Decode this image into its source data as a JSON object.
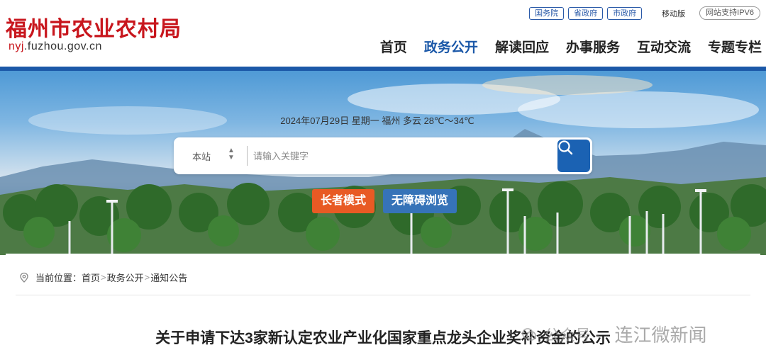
{
  "header": {
    "logo_text": "福州市农业农村局",
    "domain_prefix": "nyj",
    "domain_rest": ".fuzhou.gov.cn",
    "top_links": [
      "国务院",
      "省政府",
      "市政府"
    ],
    "mobile_label": "移动版",
    "ipv6_label": "网站支持IPV6",
    "nav": [
      "首页",
      "政务公开",
      "解读回应",
      "办事服务",
      "互动交流",
      "专题专栏"
    ],
    "active_nav": "政务公开",
    "brand_color": "#c8161d",
    "accent_color": "#1b58a8"
  },
  "banner": {
    "date_weather": "2024年07月29日  星期一  福州  多云  28℃～34℃",
    "search": {
      "scope_label": "本站",
      "placeholder": "请输入关键字",
      "button_icon": "search-icon"
    },
    "elder_mode_label": "长者模式",
    "accessible_label": "无障碍浏览"
  },
  "content": {
    "breadcrumb_prefix": "当前位置：",
    "breadcrumb": [
      "首页",
      "政务公开",
      "通知公告"
    ],
    "breadcrumb_separator": ">",
    "article_title": "关于申请下达3家新认定农业产业化国家重点龙头企业奖补资金的公示"
  },
  "watermark": {
    "source_label": "公众号 ·",
    "account_name": "连江微新闻"
  }
}
